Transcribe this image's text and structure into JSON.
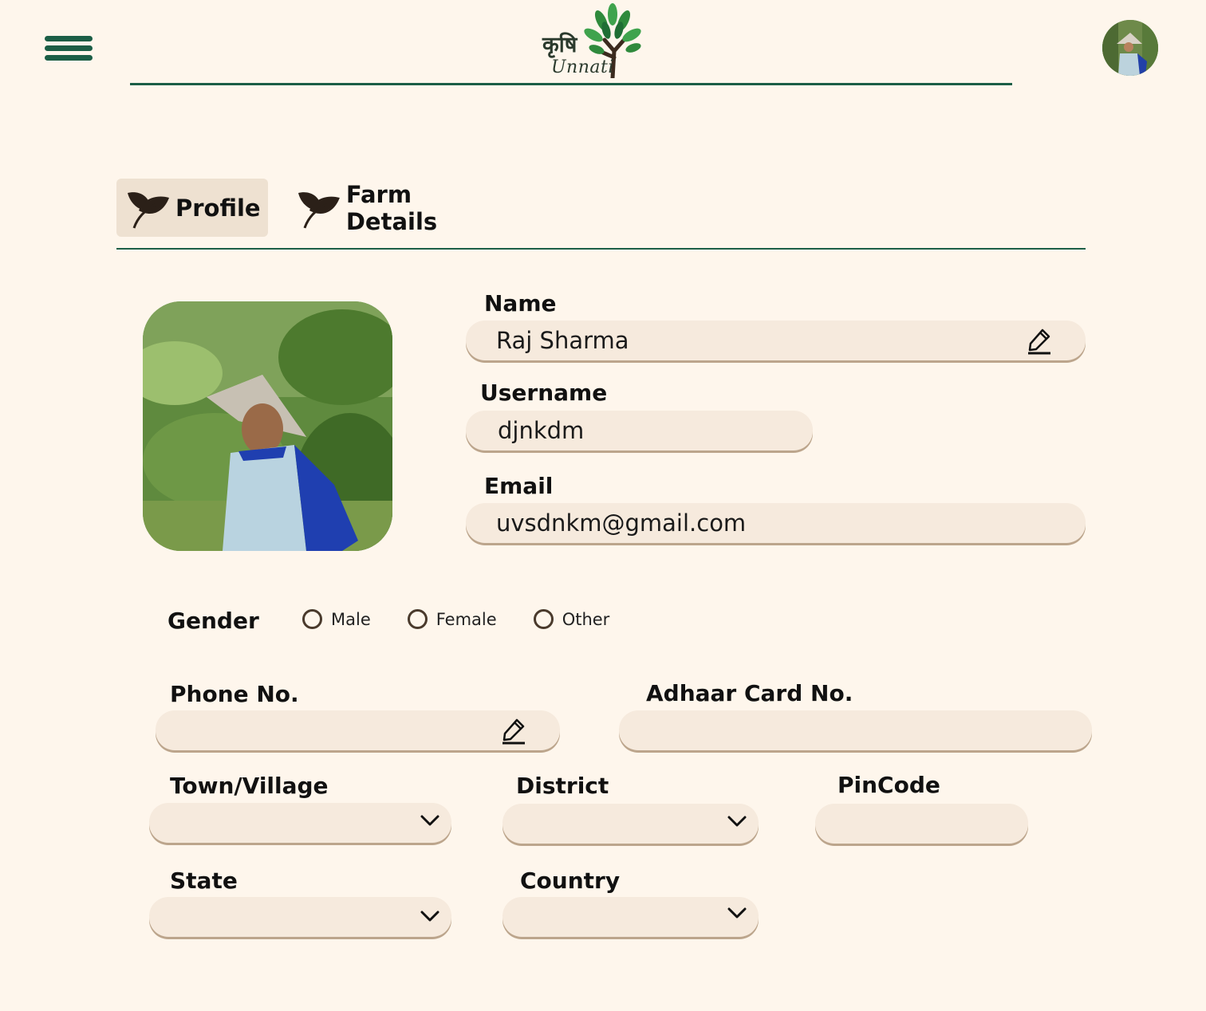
{
  "header": {
    "logo_hindi": "कृषि",
    "logo_text": "Unnati"
  },
  "tabs": [
    {
      "label": "Profile",
      "active": true
    },
    {
      "label": "Farm Details",
      "active": false
    }
  ],
  "form": {
    "name": {
      "label": "Name",
      "value": "Raj Sharma"
    },
    "username": {
      "label": "Username",
      "value": "djnkdm"
    },
    "email": {
      "label": "Email",
      "value": "uvsdnkm@gmail.com"
    },
    "gender": {
      "label": "Gender",
      "options": [
        "Male",
        "Female",
        "Other"
      ]
    },
    "phone": {
      "label": "Phone No.",
      "value": ""
    },
    "adhaar": {
      "label": "Adhaar Card No.",
      "value": ""
    },
    "town": {
      "label": "Town/Village",
      "value": ""
    },
    "district": {
      "label": "District",
      "value": ""
    },
    "pincode": {
      "label": "PinCode",
      "value": ""
    },
    "state": {
      "label": "State",
      "value": ""
    },
    "country": {
      "label": "Country",
      "value": ""
    }
  },
  "colors": {
    "background": "#FEF6EC",
    "accent": "#1B5E46",
    "field_bg": "#F6EADD",
    "field_shadow": "#BCA58C",
    "active_tab_bg": "#EEE1D1"
  },
  "icons": {
    "menu": "hamburger-icon",
    "edit": "pencil-icon",
    "dropdown": "chevron-down-icon",
    "tab": "leaf-icon"
  }
}
